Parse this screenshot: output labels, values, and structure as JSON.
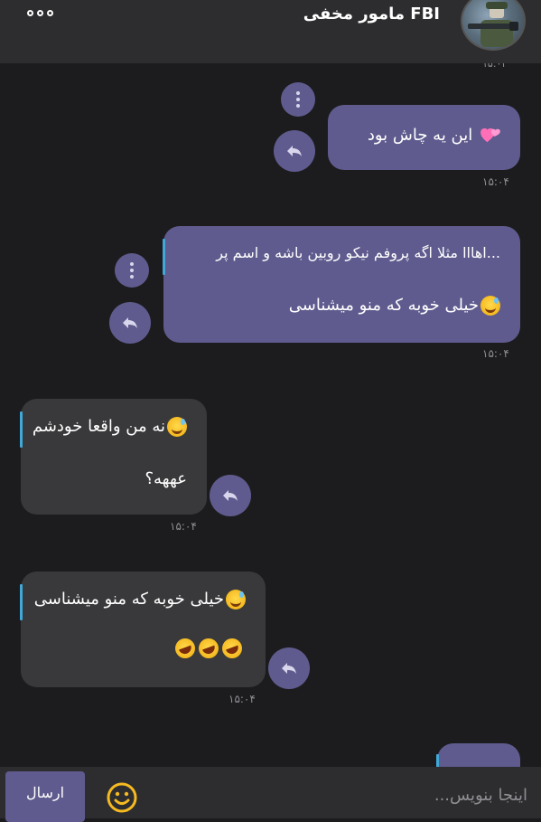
{
  "header": {
    "contact_name": "مامور مخفی FBI",
    "more_icon": "more-horizontal-icon",
    "avatar": "contact-avatar"
  },
  "messages": [
    {
      "direction": "out",
      "text": "این یه چاش بود",
      "emoji": "two-hearts",
      "time": "۱۵:۰۴"
    },
    {
      "direction": "out",
      "quote": "اهااا مثلا اگه پروفم نیکو روبین باشه و اسم پر...",
      "text": "خیلی خوبه که منو میشناسی",
      "emoji": "sweat-smile",
      "time": "۱۵:۰۴"
    },
    {
      "direction": "in",
      "quote": "نه من واقعا خودشم",
      "quote_emoji": "sweat-smile",
      "text": "عههه؟",
      "time": "۱۵:۰۴"
    },
    {
      "direction": "in",
      "quote": "خیلی خوبه که منو میشناسی",
      "quote_emoji": "sweat-smile",
      "emojis": [
        "rolling-laughing",
        "rolling-laughing",
        "rolling-laughing"
      ],
      "time": "۱۵:۰۴"
    }
  ],
  "composer": {
    "send_label": "ارسال",
    "placeholder": "اینجا بنویس...",
    "emoji_icon": "smiley-icon"
  },
  "colors": {
    "background": "#1c1c1e",
    "header": "#2d2d2f",
    "outgoing_bubble": "#5f5b8e",
    "incoming_bubble": "#39393b",
    "quote_bar": "#3fa8d8",
    "timestamp": "#8e8e93"
  }
}
